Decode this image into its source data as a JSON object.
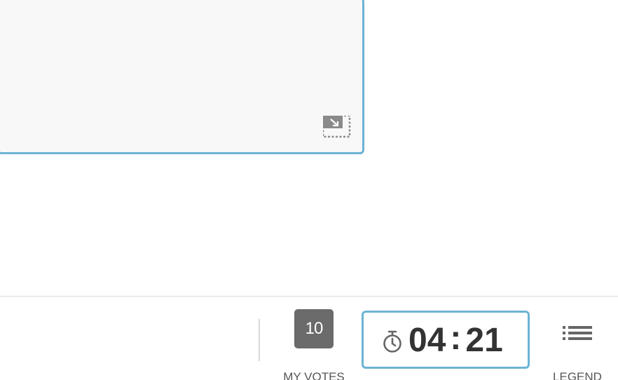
{
  "card": {
    "resize_icon": "minimize-resize-icon"
  },
  "toolbar": {
    "votes": {
      "count": "10",
      "label": "MY VOTES"
    },
    "timer": {
      "icon": "stopwatch-icon",
      "minutes": "04",
      "separator": ":",
      "seconds": "21"
    },
    "legend": {
      "icon": "list-icon",
      "label": "LEGEND"
    }
  },
  "colors": {
    "accent": "#6cb3d4",
    "badge": "#6b6b6b",
    "label": "#555555",
    "timer_text": "#333333",
    "card_bg": "#f8f8f8"
  }
}
